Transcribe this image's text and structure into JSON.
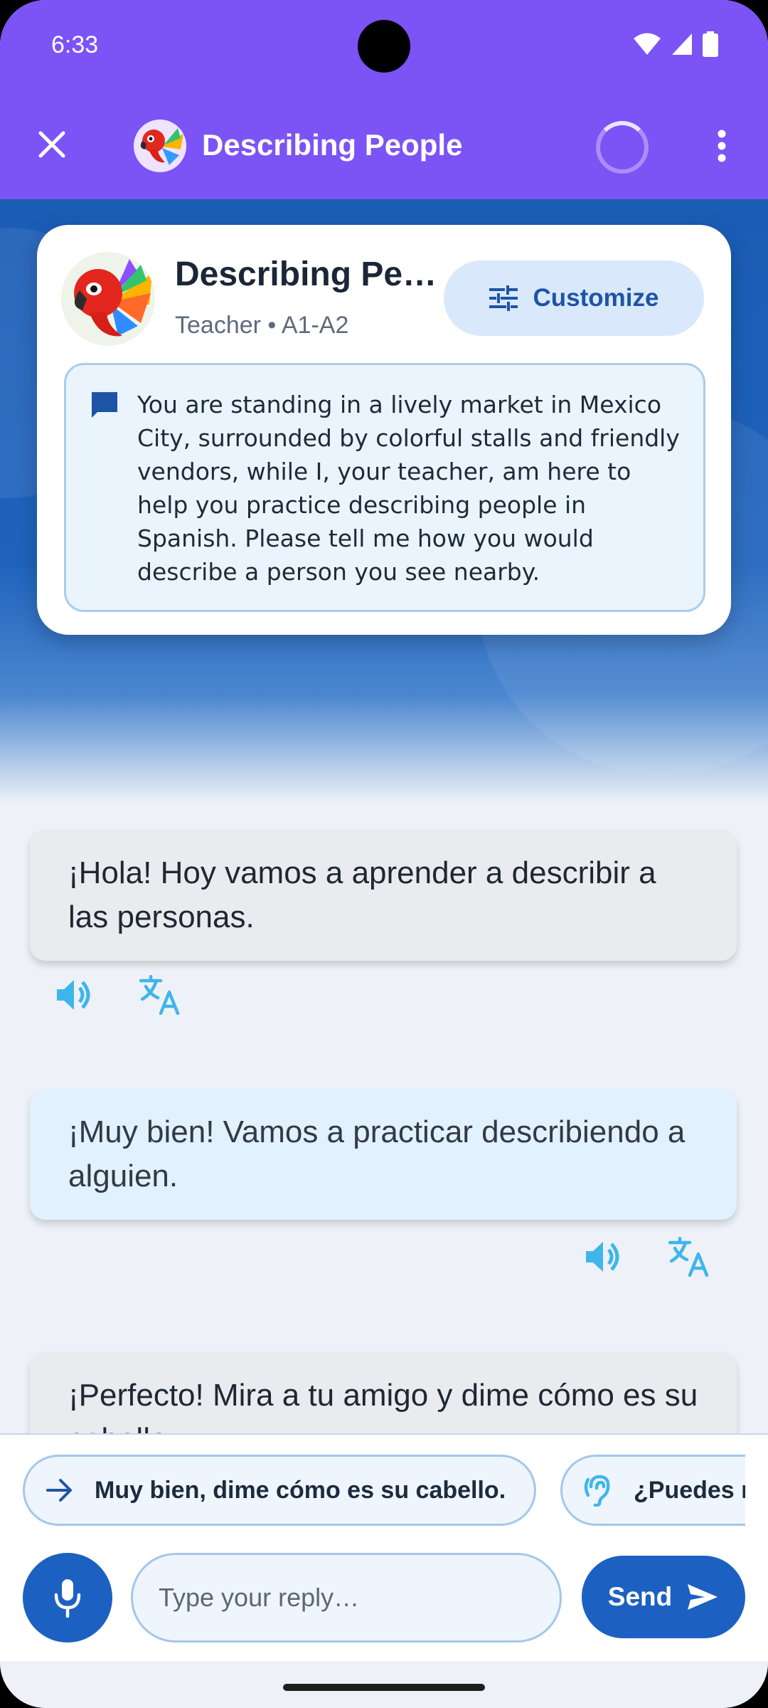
{
  "status_bar": {
    "time": "6:33"
  },
  "app_bar": {
    "title": "Describing People"
  },
  "scenario_card": {
    "title": "Describing People",
    "subtitle": "Teacher • A1-A2",
    "customize_label": "Customize",
    "description": "You are standing in a lively market in Mexico City, surrounded by colorful stalls and friendly vendors, while I, your teacher, am here to help you practice describing people in Spanish. Please tell me how you would describe a person you see nearby."
  },
  "messages": [
    {
      "role": "bot",
      "text": "¡Hola! Hoy vamos a aprender a describir a las personas."
    },
    {
      "role": "user",
      "text": "¡Muy bien! Vamos a practicar describiendo a alguien."
    },
    {
      "role": "bot",
      "text": "¡Perfecto! Mira a tu amigo y dime cómo es su cabello."
    }
  ],
  "suggestions": [
    {
      "icon": "arrow-right-icon",
      "text": "Muy bien, dime cómo es su cabello."
    },
    {
      "icon": "hearing-icon",
      "text": "¿Puedes repetir?"
    }
  ],
  "composer": {
    "placeholder": "Type your reply…",
    "send_label": "Send"
  },
  "colors": {
    "app_bar": "#7c53f5",
    "primary": "#1c60c2",
    "accent_icon": "#3fb6ea"
  }
}
